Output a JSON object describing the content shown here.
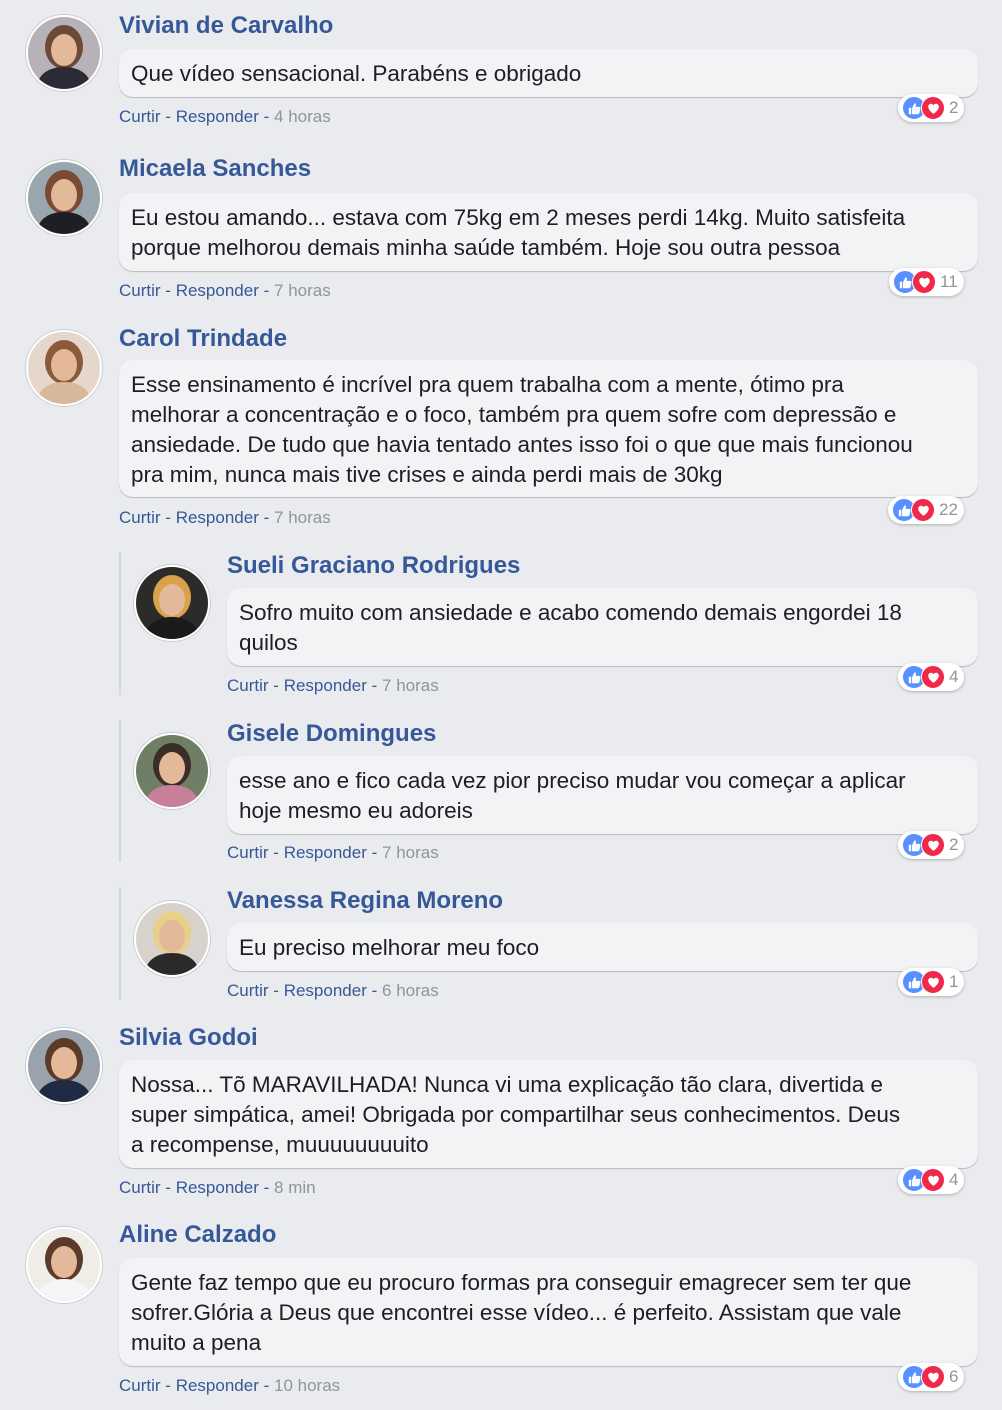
{
  "actions": {
    "like": "Curtir",
    "reply": "Responder",
    "sep": "-"
  },
  "colors": {
    "name": "#365899",
    "like": "#5890ff",
    "love": "#f0284a",
    "time": "#90949c"
  },
  "comments": [
    {
      "name": "Vivian de Carvalho",
      "text": "Que vídeo sensacional. Parabéns e obrigado",
      "time": "4 horas",
      "reactions": "2",
      "avatar_colors": [
        "#b7b2b8",
        "#6b4a3a",
        "#2c2a35"
      ]
    },
    {
      "name": "Micaela Sanches",
      "text_lines": [
        "Eu estou amando... estava com 75kg em 2 meses perdi 14kg. Muito satisfeita",
        "porque melhorou demais minha saúde também. Hoje sou outra pessoa"
      ],
      "time": "7 horas",
      "reactions": "11",
      "avatar_colors": [
        "#9aa6ad",
        "#7a4b33",
        "#1d1f24"
      ]
    },
    {
      "name": "Carol Trindade",
      "text_lines": [
        "Esse ensinamento é incrível pra quem trabalha com a mente, ótimo pra",
        "melhorar a concentração e o foco, também pra quem sofre com depressão e",
        "ansiedade. De tudo que havia tentado antes isso foi o que que mais funcionou",
        "pra mim, nunca mais tive crises e ainda perdi mais de 30kg"
      ],
      "time": "7 horas",
      "reactions": "22",
      "avatar_colors": [
        "#e6d7cc",
        "#8a5a3a",
        "#d8b89a"
      ]
    },
    {
      "name": "Sueli Graciano Rodrigues",
      "text_lines": [
        "Sofro muito com ansiedade e acabo comendo demais engordei 18",
        "quilos"
      ],
      "time": "7 horas",
      "reactions": "4",
      "avatar_colors": [
        "#2d2a2a",
        "#d7a24a",
        "#1a1a1a"
      ]
    },
    {
      "name": "Gisele Domingues",
      "text_lines": [
        "esse ano e fico cada vez pior preciso mudar vou começar a aplicar",
        "hoje mesmo eu adoreis"
      ],
      "time": "7 horas",
      "reactions": "2",
      "avatar_colors": [
        "#6f7f66",
        "#3a2d27",
        "#c8809a"
      ]
    },
    {
      "name": "Vanessa Regina Moreno",
      "text": "Eu preciso melhorar meu foco",
      "time": "6 horas",
      "reactions": "1",
      "avatar_colors": [
        "#d8d2cc",
        "#e8cf8a",
        "#2a2a2a"
      ]
    },
    {
      "name": "Silvia Godoi",
      "text_lines": [
        "Nossa... Tõ MARAVILHADA! Nunca vi uma explicação tão clara, divertida e",
        "super simpática, amei! Obrigada por compartilhar seus conhecimentos. Deus",
        "a recompense, muuuuuuuuito"
      ],
      "time": "8 min",
      "reactions": "4",
      "avatar_colors": [
        "#9aa3ad",
        "#5a3b2a",
        "#1f2a44"
      ]
    },
    {
      "name": "Aline Calzado",
      "text_lines": [
        "Gente faz tempo que eu procuro formas pra conseguir emagrecer sem ter que",
        "sofrer.Glória a Deus que encontrei esse vídeo... é perfeito. Assistam que vale",
        "muito a pena"
      ],
      "time": "10 horas",
      "reactions": "6",
      "avatar_colors": [
        "#f0ece8",
        "#5a3a2a",
        "#f5f5f5"
      ]
    }
  ]
}
